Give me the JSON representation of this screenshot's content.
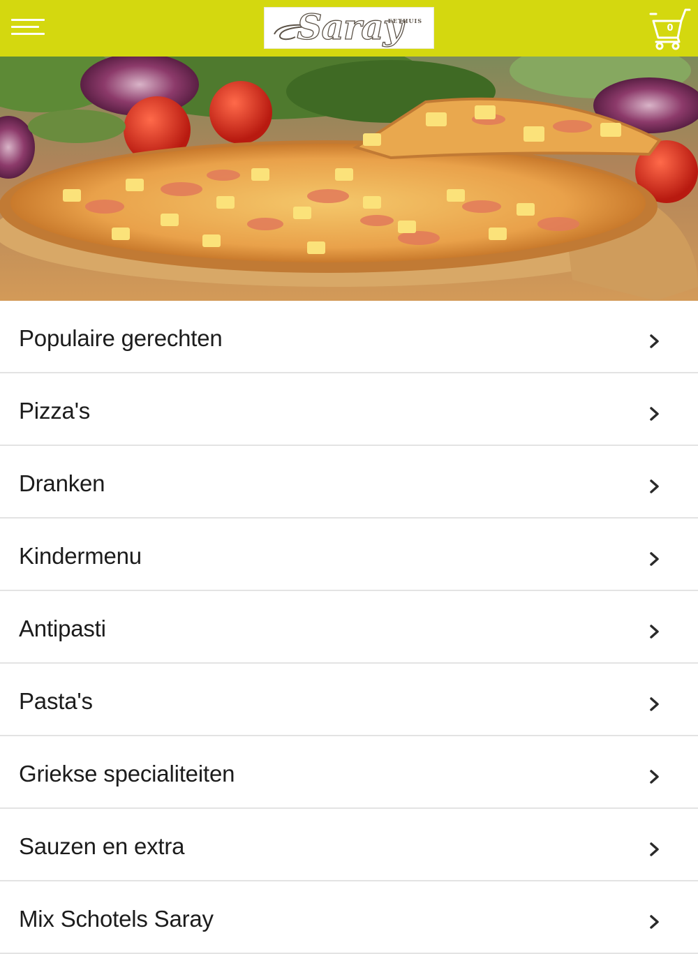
{
  "header": {
    "menu_icon": "hamburger-menu-icon",
    "logo": {
      "brand": "Saray",
      "tagline": "EETHUIS"
    },
    "cart": {
      "icon": "shopping-cart-icon",
      "count": "0"
    },
    "colors": {
      "bar": "#d4d80f",
      "icons": "#ffffff"
    }
  },
  "hero": {
    "subject": "hawaiian-pizza-photo"
  },
  "menu": {
    "chevron_icon": "chevron-right-icon",
    "items": [
      {
        "label": "Populaire gerechten"
      },
      {
        "label": "Pizza's"
      },
      {
        "label": "Dranken"
      },
      {
        "label": "Kindermenu"
      },
      {
        "label": "Antipasti"
      },
      {
        "label": "Pasta's"
      },
      {
        "label": "Griekse specialiteiten"
      },
      {
        "label": "Sauzen en extra"
      },
      {
        "label": "Mix Schotels Saray"
      }
    ]
  }
}
